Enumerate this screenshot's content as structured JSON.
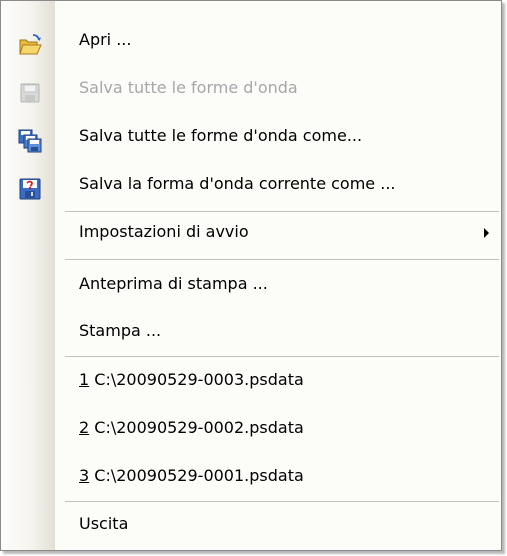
{
  "menu": {
    "items": [
      {
        "label": "Apri ...",
        "icon": "open-folder-icon",
        "enabled": true
      },
      {
        "label": "Salva tutte le forme d'onda",
        "icon": "save-disk-icon",
        "enabled": false
      },
      {
        "label": "Salva tutte le forme d'onda come...",
        "icon": "save-multiple-icon",
        "enabled": true
      },
      {
        "label": "Salva la forma d'onda corrente come ...",
        "icon": "save-current-waveform-icon",
        "enabled": true
      },
      {
        "label": "Impostazioni di avvio",
        "enabled": true,
        "has_submenu": true
      },
      {
        "label": "Anteprima di stampa ...",
        "enabled": true
      },
      {
        "label": "Stampa ...",
        "enabled": true
      }
    ],
    "recent_files": [
      {
        "index": "1",
        "path": " C:\\20090529-0003.psdata"
      },
      {
        "index": "2",
        "path": " C:\\20090529-0002.psdata"
      },
      {
        "index": "3",
        "path": " C:\\20090529-0001.psdata"
      }
    ],
    "exit_label": "Uscita"
  },
  "colors": {
    "disabled_text": "#a7a6aa",
    "separator": "#c5c2b8",
    "menu_background": "#fcfcf9"
  }
}
